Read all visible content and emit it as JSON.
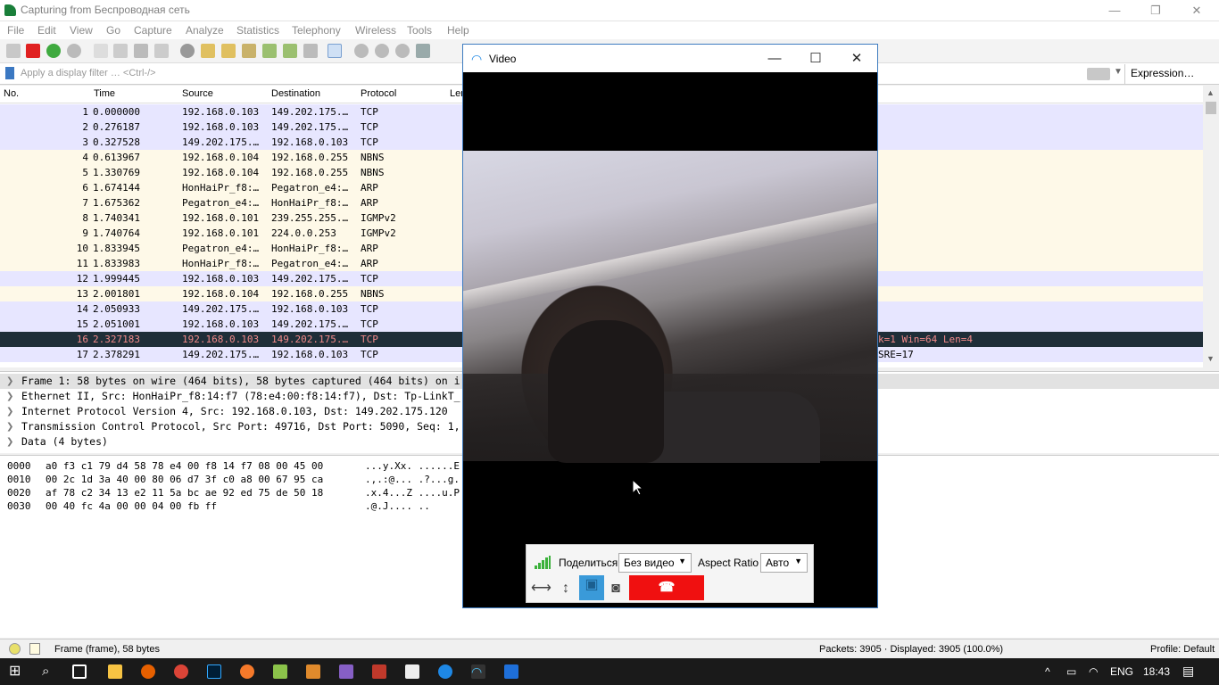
{
  "wireshark": {
    "title": "Capturing from Беспроводная сеть",
    "menu": [
      "File",
      "Edit",
      "View",
      "Go",
      "Capture",
      "Analyze",
      "Statistics",
      "Telephony",
      "Wireless",
      "Tools",
      "Help"
    ],
    "filter_placeholder": "Apply a display filter … <Ctrl-/>",
    "expression_label": "Expression…",
    "columns": [
      "No.",
      "Time",
      "Source",
      "Destination",
      "Protocol",
      "Len"
    ],
    "packets": [
      {
        "no": "1",
        "time": "0.000000",
        "src": "192.168.0.103",
        "dst": "149.202.175.…",
        "proto": "TCP",
        "info": "",
        "kind": "tcp"
      },
      {
        "no": "2",
        "time": "0.276187",
        "src": "192.168.0.103",
        "dst": "149.202.175.…",
        "proto": "TCP",
        "info": "",
        "kind": "tcp"
      },
      {
        "no": "3",
        "time": "0.327528",
        "src": "149.202.175.…",
        "dst": "192.168.0.103",
        "proto": "TCP",
        "info": "",
        "kind": "tcp"
      },
      {
        "no": "4",
        "time": "0.613967",
        "src": "192.168.0.104",
        "dst": "192.168.0.255",
        "proto": "NBNS",
        "info": "",
        "kind": "other"
      },
      {
        "no": "5",
        "time": "1.330769",
        "src": "192.168.0.104",
        "dst": "192.168.0.255",
        "proto": "NBNS",
        "info": "",
        "kind": "other"
      },
      {
        "no": "6",
        "time": "1.674144",
        "src": "HonHaiPr_f8:…",
        "dst": "Pegatron_e4:…",
        "proto": "ARP",
        "info": "",
        "kind": "other"
      },
      {
        "no": "7",
        "time": "1.675362",
        "src": "Pegatron_e4:…",
        "dst": "HonHaiPr_f8:…",
        "proto": "ARP",
        "info": "",
        "kind": "other"
      },
      {
        "no": "8",
        "time": "1.740341",
        "src": "192.168.0.101",
        "dst": "239.255.255.…",
        "proto": "IGMPv2",
        "info": "",
        "kind": "other"
      },
      {
        "no": "9",
        "time": "1.740764",
        "src": "192.168.0.101",
        "dst": "224.0.0.253",
        "proto": "IGMPv2",
        "info": "",
        "kind": "other"
      },
      {
        "no": "10",
        "time": "1.833945",
        "src": "Pegatron_e4:…",
        "dst": "HonHaiPr_f8:…",
        "proto": "ARP",
        "info": "",
        "kind": "other"
      },
      {
        "no": "11",
        "time": "1.833983",
        "src": "HonHaiPr_f8:…",
        "dst": "Pegatron_e4:…",
        "proto": "ARP",
        "info": "",
        "kind": "other"
      },
      {
        "no": "12",
        "time": "1.999445",
        "src": "192.168.0.103",
        "dst": "149.202.175.…",
        "proto": "TCP",
        "info": "",
        "kind": "tcp"
      },
      {
        "no": "13",
        "time": "2.001801",
        "src": "192.168.0.104",
        "dst": "192.168.0.255",
        "proto": "NBNS",
        "info": "",
        "kind": "other"
      },
      {
        "no": "14",
        "time": "2.050933",
        "src": "149.202.175.…",
        "dst": "192.168.0.103",
        "proto": "TCP",
        "info": "",
        "kind": "tcp"
      },
      {
        "no": "15",
        "time": "2.051001",
        "src": "192.168.0.103",
        "dst": "149.202.175.…",
        "proto": "TCP",
        "info": "",
        "kind": "tcp"
      },
      {
        "no": "16",
        "time": "2.327183",
        "src": "192.168.0.103",
        "dst": "149.202.175.…",
        "proto": "TCP",
        "info": "k=1 Win=64 Len=4",
        "kind": "sel"
      },
      {
        "no": "17",
        "time": "2.378291",
        "src": "149.202.175.…",
        "dst": "192.168.0.103",
        "proto": "TCP",
        "info": "SRE=17",
        "kind": "tcp"
      }
    ],
    "details": [
      "Frame 1: 58 bytes on wire (464 bits), 58 bytes captured (464 bits) on i",
      "Ethernet II, Src: HonHaiPr_f8:14:f7 (78:e4:00:f8:14:f7), Dst: Tp-LinkT_",
      "Internet Protocol Version 4, Src: 192.168.0.103, Dst: 149.202.175.120",
      "Transmission Control Protocol, Src Port: 49716, Dst Port: 5090, Seq: 1,",
      "Data (4 bytes)"
    ],
    "bytes": [
      {
        "off": "0000",
        "hex": "a0 f3 c1 79 d4 58 78 e4  00 f8 14 f7 08 00 45 00",
        "ascii": "...y.Xx. ......E"
      },
      {
        "off": "0010",
        "hex": "00 2c 1d 3a 40 00 80 06  d7 3f c0 a8 00 67 95 ca",
        "ascii": ".,.:@... .?...g."
      },
      {
        "off": "0020",
        "hex": "af 78 c2 34 13 e2 11 5a  bc ae 92 ed 75 de 50 18",
        "ascii": ".x.4...Z ....u.P"
      },
      {
        "off": "0030",
        "hex": "00 40 fc 4a 00 00 04 00  fb ff",
        "ascii": ".@.J.... .."
      }
    ],
    "status": {
      "frame": "Frame (frame), 58 bytes",
      "packets": "Packets: 3905 · Displayed: 3905 (100.0%)",
      "profile": "Profile: Default"
    }
  },
  "video": {
    "title": "Video",
    "share_label": "Поделиться",
    "share_value": "Без видео",
    "aspect_label": "Aspect Ratio",
    "aspect_value": "Авто",
    "hangup_glyph": "☎"
  },
  "taskbar": {
    "lang": "ENG",
    "clock": "18:43"
  },
  "colors": {
    "tcp_row": "#e7e6ff",
    "other_row": "#fef9e8",
    "selected_row": "#1f2e38",
    "hangup": "#f01010",
    "accent": "#3e7cc0"
  }
}
